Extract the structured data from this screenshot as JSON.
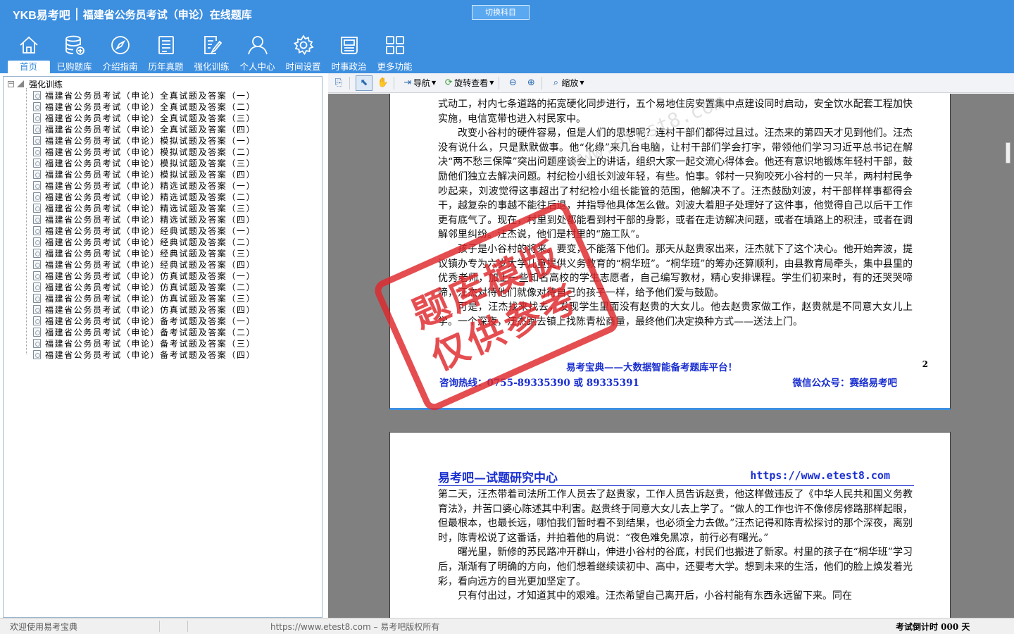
{
  "header": {
    "logo": "YKB易考吧",
    "title": "福建省公务员考试（申论）在线题库",
    "switch_button": "切换科目",
    "accent_color": "#3d8fe0"
  },
  "nav": [
    {
      "label": "首页",
      "icon": "home-icon"
    },
    {
      "label": "已购题库",
      "icon": "database-icon"
    },
    {
      "label": "介绍指南",
      "icon": "compass-icon"
    },
    {
      "label": "历年真题",
      "icon": "list-doc-icon"
    },
    {
      "label": "强化训练",
      "icon": "edit-doc-icon"
    },
    {
      "label": "个人中心",
      "icon": "user-icon"
    },
    {
      "label": "时间设置",
      "icon": "gear-icon"
    },
    {
      "label": "时事政治",
      "icon": "news-icon"
    },
    {
      "label": "更多功能",
      "icon": "grid-icon"
    }
  ],
  "tree": {
    "root": "强化训练",
    "items": [
      "福建省公务员考试（申论）全真试题及答案（一）",
      "福建省公务员考试（申论）全真试题及答案（二）",
      "福建省公务员考试（申论）全真试题及答案（三）",
      "福建省公务员考试（申论）全真试题及答案（四）",
      "福建省公务员考试（申论）模拟试题及答案（一）",
      "福建省公务员考试（申论）模拟试题及答案（二）",
      "福建省公务员考试（申论）模拟试题及答案（三）",
      "福建省公务员考试（申论）模拟试题及答案（四）",
      "福建省公务员考试（申论）精选试题及答案（一）",
      "福建省公务员考试（申论）精选试题及答案（二）",
      "福建省公务员考试（申论）精选试题及答案（三）",
      "福建省公务员考试（申论）精选试题及答案（四）",
      "福建省公务员考试（申论）经典试题及答案（一）",
      "福建省公务员考试（申论）经典试题及答案（二）",
      "福建省公务员考试（申论）经典试题及答案（三）",
      "福建省公务员考试（申论）经典试题及答案（四）",
      "福建省公务员考试（申论）仿真试题及答案（一）",
      "福建省公务员考试（申论）仿真试题及答案（二）",
      "福建省公务员考试（申论）仿真试题及答案（三）",
      "福建省公务员考试（申论）仿真试题及答案（四）",
      "福建省公务员考试（申论）备考试题及答案（一）",
      "福建省公务员考试（申论）备考试题及答案（二）",
      "福建省公务员考试（申论）备考试题及答案（三）",
      "福建省公务员考试（申论）备考试题及答案（四）"
    ]
  },
  "toolbar": {
    "navigate": "导航",
    "rotate": "旋转查看",
    "zoom": "缩放"
  },
  "page1": {
    "paragraphs": [
      "式动工，村内七条道路的拓宽硬化同步进行，五个易地住房安置集中点建设同时启动，安全饮水配套工程加快实施，电信宽带也进入村民家中。",
      "改变小谷村的硬件容易，但是人们的思想呢？连村干部们都得过且过。汪杰来的第四天才见到他们。汪杰没有说什么，只是默默做事。他“化缘”来几台电脑，让村干部们学会打字，带领他们学习习近平总书记在解决“两不愁三保障”突出问题座谈会上的讲话，组织大家一起交流心得体会。他还有意识地锻炼年轻村干部，鼓励他们独立去解决问题。村纪检小组长刘波年轻，有些。怕事。邻村一只狗咬死小谷村的一只羊，两村村民争吵起来，刘波觉得这事超出了村纪检小组长能管的范围，他解决不了。汪杰鼓励刘波，村干部样样事都得会干，越复杂的事越不能往后退，并指导他具体怎么做。刘波大着胆子处理好了这件事，他觉得自己以后干工作更有底气了。现在，村里到处都能看到村干部的身影，或者在走访解决问题，或者在填路上的积洼，或者在调解邻里纠纷。汪杰说，他们是村里的“施工队”。",
      "孩子是小谷村的将来。要变，不能落下他们。那天从赵贵家出来，汪杰就下了这个决心。他开始奔波，提议镇办专为六岁大学儿童提供义务教育的“桐华班”。“桐华班”的筹办还算顺利，由县教育局牵头，集中县里的优秀老师，加上一些知名高校的学生志愿者，自己编写教材，精心安排课程。学生们初来时，有的还哭哭啼啼，汪杰对待他们就像对待自己的孩子一样，给予他们爱与鼓励。",
      "可是，汪杰找来找去，发现学生里面没有赵贵的大女儿。他去赵贵家做工作，赵贵就是不同意大女儿上学。一个深夜，汪杰跑去镇上找陈青松商量，最终他们决定换种方式——送法上门。"
    ],
    "slogan": "易考宝典——大数据智能备考题库平台！",
    "page_number": "2",
    "hotline": "咨询热线：0755-89335390 或 89335391",
    "wechat": "微信公众号：赛络易考吧"
  },
  "page2": {
    "heading": "易考吧—试题研究中心",
    "url": "https://www.etest8.com",
    "paragraphs": [
      "第二天，汪杰带着司法所工作人员去了赵贵家，工作人员告诉赵贵，他这样做违反了《中华人民共和国义务教育法》，并苦口婆心陈述其中利害。赵贵终于同意大女儿去上学了。“做人的工作也许不像修房修路那样起眼，但最根本，也最长远，哪怕我们暂时看不到结果，也必须全力去做。”汪杰记得和陈青松探讨的那个深夜，离别时，陈青松说了这番话，并拍着他的肩说：“夜色难免黑凉，前行必有曙光。”",
      "曙光里，新修的苏民路冲开群山，伸进小谷村的谷底，村民们也搬进了新家。村里的孩子在“桐华班”学习后，渐渐有了明确的方向，他们想着继续读初中、高中，还要考大学。想到未来的生活，他们的脸上焕发着光彩，看向远方的目光更加坚定了。",
      "只有付出过，才知道其中的艰难。汪杰希望自己离开后，小谷村能有东西永远留下来。同在"
    ]
  },
  "watermark": {
    "stamp_line1": "题库模版",
    "stamp_line2": "仅供参考",
    "stamp_color": "#e0282c",
    "site": "www.etest8.com"
  },
  "status": {
    "welcome": "欢迎使用易考宝典",
    "copyright": "https://www.etest8.com – 易考吧版权所有",
    "countdown": "考试倒计时 000 天"
  }
}
